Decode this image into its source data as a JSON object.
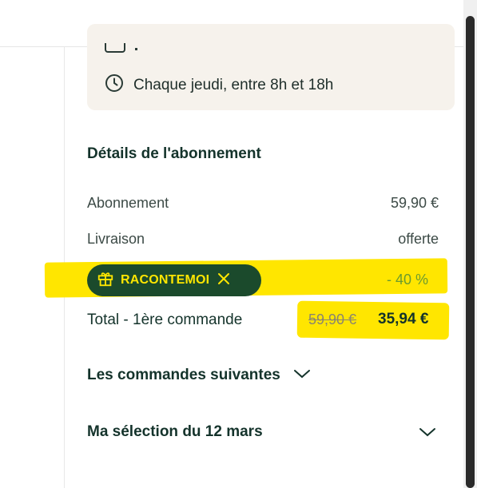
{
  "delivery": {
    "schedule": "Chaque jeudi, entre 8h et 18h",
    "partial_icon": "calendar-icon",
    "schedule_icon": "clock-icon"
  },
  "subscription": {
    "title": "Détails de l'abonnement",
    "rows": [
      {
        "label": "Abonnement",
        "value": "59,90 €"
      },
      {
        "label": "Livraison",
        "value": "offerte"
      }
    ],
    "promo": {
      "code": "RACONTEMOI",
      "discount": "- 40 %",
      "gift_icon": "gift-icon",
      "remove_icon": "close-icon"
    },
    "total": {
      "label": "Total - 1ère commande",
      "old_price": "59,90 €",
      "new_price": "35,94 €"
    }
  },
  "accordions": {
    "next_orders": "Les commandes suivantes",
    "selection": "Ma sélection du 12 mars"
  },
  "colors": {
    "promo_chip_bg": "#1b4a2c",
    "promo_text": "#ffe600",
    "highlight": "#ffe600",
    "discount": "#6b9b2e",
    "heading": "#14332b",
    "card_bg": "#f6f2ec"
  }
}
